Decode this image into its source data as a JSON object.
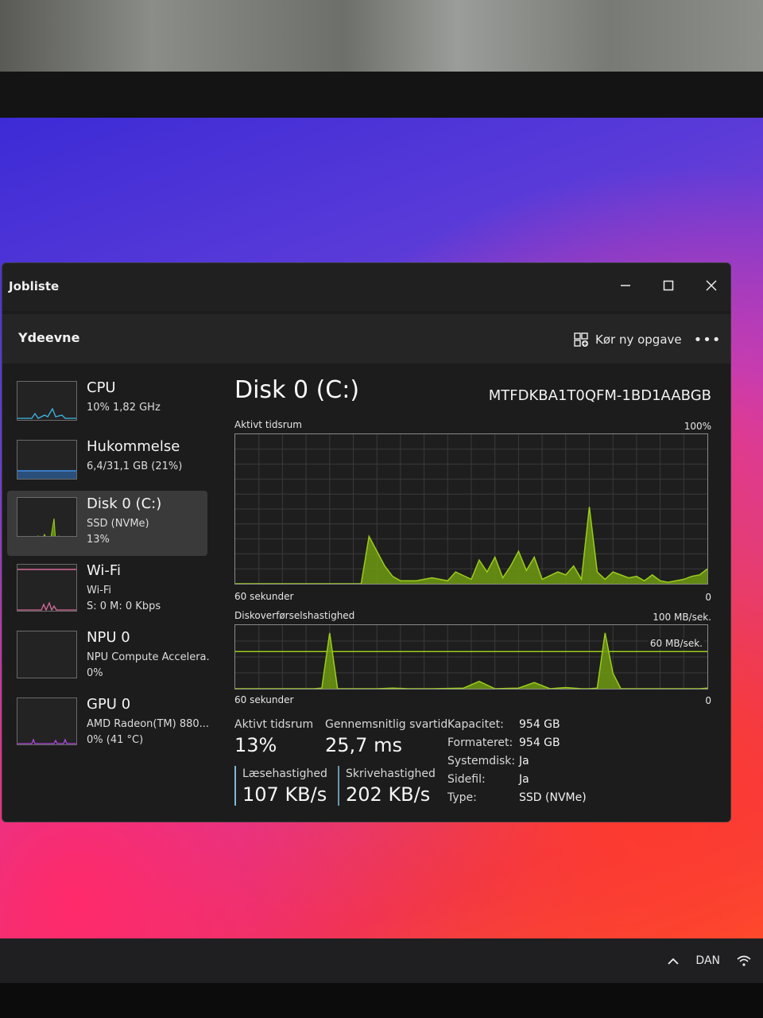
{
  "window": {
    "title": "Jobliste"
  },
  "header": {
    "section": "Ydeevne",
    "run_task": "Kør ny opgave",
    "more": "•••"
  },
  "sidebar": {
    "items": [
      {
        "title": "CPU",
        "line1": "10%  1,82 GHz",
        "line2": "",
        "active": false
      },
      {
        "title": "Hukommelse",
        "line1": "6,4/31,1 GB (21%)",
        "line2": "",
        "active": false
      },
      {
        "title": "Disk 0 (C:)",
        "line1": "SSD (NVMe)",
        "line2": "13%",
        "active": true
      },
      {
        "title": "Wi-Fi",
        "line1": "Wi-Fi",
        "line2": "S: 0  M: 0 Kbps",
        "active": false
      },
      {
        "title": "NPU 0",
        "line1": "NPU Compute Accelera.",
        "line2": "0%",
        "active": false
      },
      {
        "title": "GPU 0",
        "line1": "AMD Radeon(TM) 880...",
        "line2": "0% (41 °C)",
        "active": false
      }
    ]
  },
  "main": {
    "title": "Disk 0 (C:)",
    "model": "MTFDKBA1T0QFM-1BD1AABGB",
    "graph1": {
      "label": "Aktivt tidsrum",
      "max": "100%",
      "time": "60 sekunder",
      "min": "0"
    },
    "graph2": {
      "label": "Diskoverførselshastighed",
      "max": "100 MB/sek.",
      "ref_label": "60 MB/sek.",
      "time": "60 sekunder",
      "min": "0"
    },
    "stats": {
      "active_label": "Aktivt tidsrum",
      "active_value": "13%",
      "response_label": "Gennemsnitlig svartid",
      "response_value": "25,7 ms",
      "read_label": "Læsehastighed",
      "read_value": "107 KB/s",
      "write_label": "Skrivehastighed",
      "write_value": "202 KB/s"
    },
    "properties": [
      {
        "label": "Kapacitet:",
        "value": "954 GB"
      },
      {
        "label": "Formateret:",
        "value": "954 GB"
      },
      {
        "label": "Systemdisk:",
        "value": "Ja"
      },
      {
        "label": "Sidefil:",
        "value": "Ja"
      },
      {
        "label": "Type:",
        "value": "SSD (NVMe)"
      }
    ]
  },
  "taskbar": {
    "language": "DAN"
  },
  "chart_data": [
    {
      "type": "area",
      "title": "Aktivt tidsrum",
      "xlabel": "60 sekunder",
      "ylim": [
        0,
        100
      ],
      "x": [
        60,
        57,
        55,
        53,
        51,
        49,
        47,
        45,
        44,
        43,
        41,
        40,
        39,
        37,
        35,
        33,
        32,
        30,
        29,
        28,
        27,
        26,
        25,
        24,
        23,
        22,
        21,
        19,
        18,
        17,
        16,
        15,
        14,
        13,
        12,
        10,
        9,
        8,
        7,
        6,
        5,
        4,
        3,
        2,
        1,
        0
      ],
      "values": [
        0,
        0,
        0,
        0,
        0,
        0,
        0,
        0,
        0,
        32,
        12,
        5,
        2,
        2,
        4,
        2,
        8,
        3,
        16,
        8,
        18,
        4,
        12,
        22,
        9,
        18,
        3,
        8,
        6,
        12,
        3,
        52,
        8,
        3,
        8,
        4,
        5,
        2,
        6,
        2,
        1,
        2,
        3,
        5,
        6,
        10
      ],
      "series": [
        {
          "name": "",
          "color": "#9ccc1c"
        }
      ]
    },
    {
      "type": "area",
      "title": "Diskoverførselshastighed",
      "xlabel": "60 sekunder",
      "ylim": [
        0,
        100
      ],
      "reference_line": 60,
      "x": [
        60,
        57,
        55,
        53,
        51,
        50,
        49,
        48,
        47,
        46,
        44,
        42,
        40,
        38,
        35,
        31,
        29,
        27,
        24,
        22,
        20,
        18,
        16,
        15,
        14,
        13,
        12,
        11,
        10,
        8,
        6,
        4,
        2,
        1,
        0
      ],
      "values": [
        0,
        0,
        0,
        0,
        0,
        0,
        1,
        90,
        0,
        0,
        0,
        0,
        1,
        0,
        0,
        1,
        12,
        0,
        1,
        10,
        0,
        2,
        0,
        0,
        1,
        90,
        25,
        0,
        0,
        0,
        0,
        0,
        0,
        0,
        1
      ],
      "series": [
        {
          "name": "",
          "color": "#9ccc1c"
        }
      ]
    }
  ]
}
